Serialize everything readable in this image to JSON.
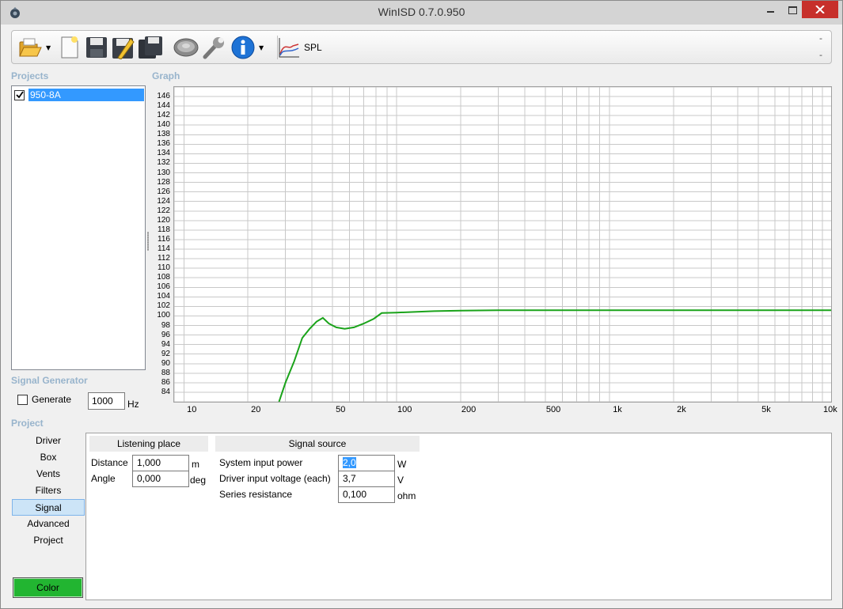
{
  "window": {
    "title": "WinISD 0.7.0.950"
  },
  "toolbar": {
    "icons": [
      "open-folder-icon",
      "new-document-icon",
      "save-icon",
      "save-as-icon",
      "save-all-icon",
      "driver-icon",
      "wrench-icon",
      "info-icon",
      "spl-chart-icon"
    ],
    "spl_label": "SPL",
    "dash_top": "-",
    "dash_bottom": "-"
  },
  "projects": {
    "label": "Projects",
    "items": [
      {
        "name": "950-8A",
        "checked": true
      }
    ]
  },
  "graph": {
    "label": "Graph"
  },
  "chart_data": {
    "type": "line",
    "title": "",
    "xlabel": "",
    "ylabel": "",
    "x_scale": "log",
    "xlim": [
      9,
      11000
    ],
    "ylim": [
      82,
      148
    ],
    "grid": true,
    "y_ticks": [
      "146",
      "144",
      "142",
      "140",
      "138",
      "136",
      "134",
      "132",
      "130",
      "128",
      "126",
      "124",
      "122",
      "120",
      "118",
      "116",
      "114",
      "112",
      "110",
      "108",
      "106",
      "104",
      "102",
      "100",
      "98",
      "96",
      "94",
      "92",
      "90",
      "88",
      "86",
      "84"
    ],
    "x_ticks": [
      {
        "value": 10,
        "label": "10"
      },
      {
        "value": 20,
        "label": "20"
      },
      {
        "value": 50,
        "label": "50"
      },
      {
        "value": 100,
        "label": "100"
      },
      {
        "value": 200,
        "label": "200"
      },
      {
        "value": 500,
        "label": "500"
      },
      {
        "value": 1000,
        "label": "1k"
      },
      {
        "value": 2000,
        "label": "2k"
      },
      {
        "value": 5000,
        "label": "5k"
      },
      {
        "value": 10000,
        "label": "10k"
      }
    ],
    "series": [
      {
        "color": "#1aa31a",
        "points": [
          [
            28,
            82
          ],
          [
            30,
            86
          ],
          [
            33,
            90.5
          ],
          [
            36,
            95.4
          ],
          [
            39,
            97.3
          ],
          [
            42,
            98.8
          ],
          [
            45,
            99.6
          ],
          [
            48,
            98.4
          ],
          [
            52,
            97.6
          ],
          [
            57,
            97.3
          ],
          [
            63,
            97.6
          ],
          [
            70,
            98.4
          ],
          [
            78,
            99.4
          ],
          [
            85,
            100.6
          ],
          [
            100,
            100.7
          ],
          [
            150,
            101.0
          ],
          [
            200,
            101.1
          ],
          [
            300,
            101.2
          ],
          [
            1000,
            101.2
          ],
          [
            10000,
            101.2
          ],
          [
            11000,
            101.2
          ]
        ]
      }
    ]
  },
  "signal_generator": {
    "label": "Signal Generator",
    "generate_label": "Generate",
    "generate_checked": false,
    "frequency": "1000",
    "unit": "Hz"
  },
  "project": {
    "label": "Project",
    "nav": [
      "Driver",
      "Box",
      "Vents",
      "Filters",
      "Signal",
      "Advanced",
      "Project"
    ],
    "active": "Signal",
    "color_button": "Color",
    "color_button_bg": "#22b531"
  },
  "listening_place": {
    "header": "Listening place",
    "distance_label": "Distance",
    "distance_value": "1,000",
    "distance_unit": "m",
    "angle_label": "Angle",
    "angle_value": "0,000",
    "angle_unit": "deg"
  },
  "signal_source": {
    "header": "Signal source",
    "power_label": "System input power",
    "power_value": "2,0",
    "power_unit": "W",
    "voltage_label": "Driver input voltage (each)",
    "voltage_value": "3,7",
    "voltage_unit": "V",
    "resistance_label": "Series resistance",
    "resistance_value": "0,100",
    "resistance_unit": "ohm"
  }
}
